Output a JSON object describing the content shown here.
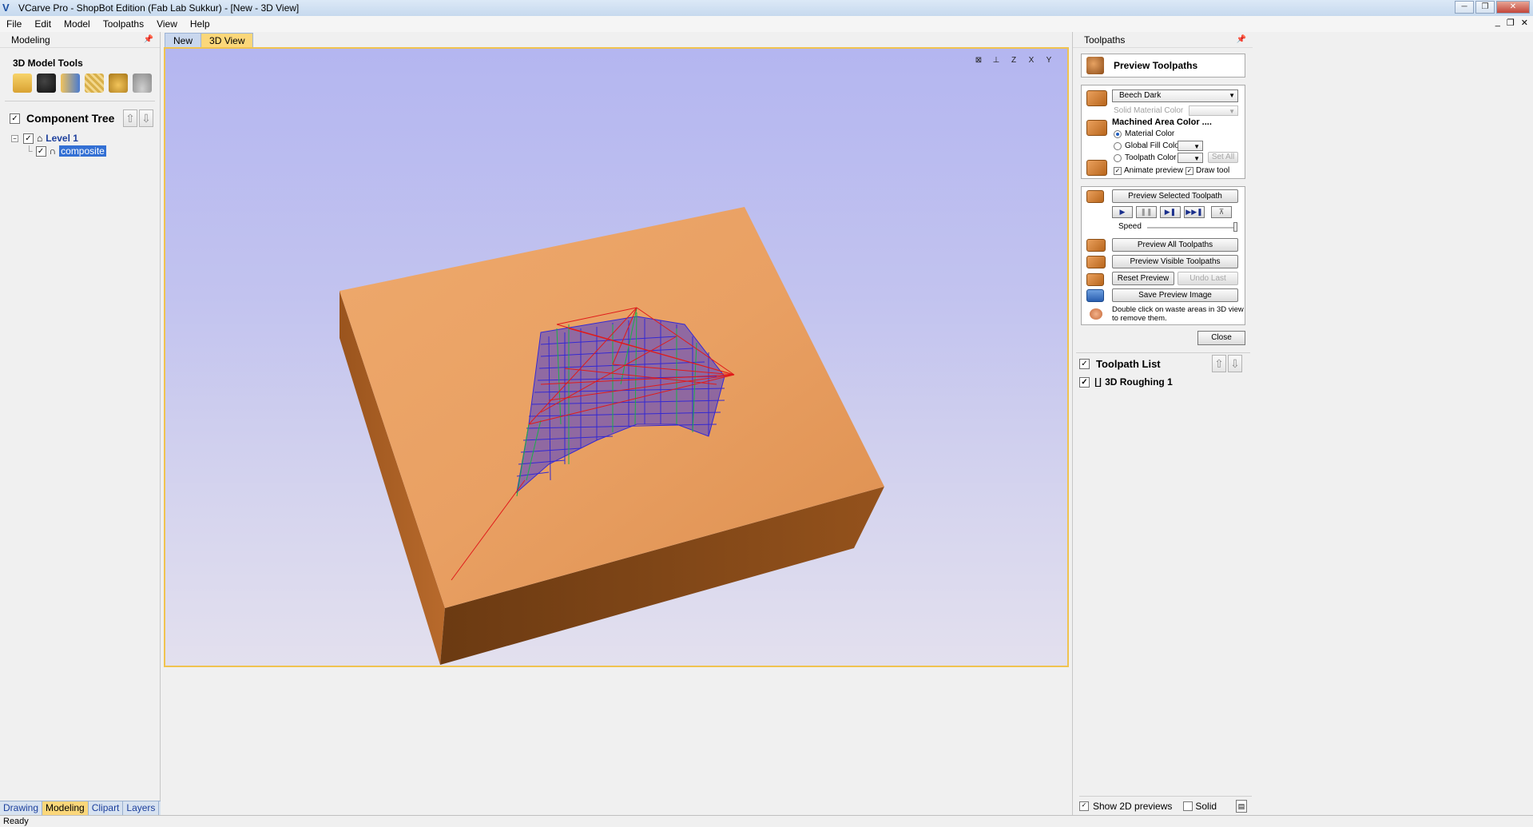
{
  "window": {
    "title": "VCarve Pro - ShopBot Edition (Fab Lab Sukkur) - [New - 3D View]",
    "app_icon": "V",
    "minimize": "─",
    "maximize": "❐",
    "close": "✕"
  },
  "menu": {
    "items": [
      "File",
      "Edit",
      "Model",
      "Toolpaths",
      "View",
      "Help"
    ],
    "mdi_minimize": "_",
    "mdi_restore": "❐",
    "mdi_close": "✕"
  },
  "left_panel": {
    "header": "Modeling",
    "pin": "📌",
    "tools_title": "3D Model Tools",
    "tool_icons": [
      "open-folder-icon",
      "wrench-icon",
      "arrow-icon",
      "grid-icon",
      "lock-icon",
      "heap-icon"
    ],
    "component_tree": {
      "label": "Component Tree",
      "checked": "✓",
      "up": "⇧",
      "down": "⇩",
      "expander": "−",
      "level": "Level 1",
      "component": "composite"
    },
    "bottom_tabs": [
      "Drawing",
      "Modeling",
      "Clipart",
      "Layers"
    ],
    "active_tab": "Modeling"
  },
  "document_tabs": [
    "New",
    "3D View"
  ],
  "active_document_tab": "3D View",
  "view_icons": [
    "⊠",
    "⊥",
    "Z",
    "X",
    "Y"
  ],
  "right_panel": {
    "header": "Toolpaths",
    "pin": "📌",
    "preview_title": "Preview Toolpaths",
    "material": "Beech Dark",
    "solid_material_color": "Solid Material Color",
    "machined_area_color": "Machined Area Color ....",
    "radio_material": "Material Color",
    "radio_global": "Global Fill Color",
    "radio_toolpath": "Toolpath Color",
    "set_all": "Set All",
    "animate_preview": "Animate preview",
    "draw_tool": "Draw tool",
    "preview_selected": "Preview Selected Toolpath",
    "play_icons": [
      "▶",
      "❚❚",
      "▶❚",
      "▶▶❚",
      "⊼"
    ],
    "speed_label": "Speed",
    "speed_level": 1.0,
    "preview_all": "Preview All Toolpaths",
    "preview_visible": "Preview Visible Toolpaths",
    "reset_preview": "Reset Preview",
    "undo_last": "Undo Last",
    "save_preview_image": "Save Preview Image",
    "hint_line1": "Double click on waste areas in 3D view",
    "hint_line2": "to remove them.",
    "close": "Close",
    "toolpath_list_label": "Toolpath List",
    "toolpath_item": "3D Roughing 1",
    "show_2d_previews": "Show 2D previews",
    "solid": "Solid"
  },
  "status": {
    "text": "Ready"
  },
  "colors": {
    "active_tab": "#fbd77a",
    "wood_top": "#e9a063",
    "wood_side": "#a35c22",
    "toolpath_blue": "#1010e0",
    "toolpath_red": "#e01010",
    "toolpath_green": "#10b040"
  }
}
